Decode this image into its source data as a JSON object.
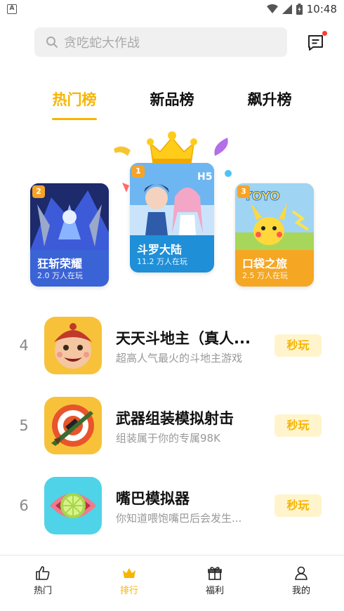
{
  "status_bar": {
    "time": "10:48"
  },
  "search": {
    "placeholder": "贪吃蛇大作战"
  },
  "tabs": [
    {
      "label": "热门榜",
      "active": true
    },
    {
      "label": "新品榜",
      "active": false
    },
    {
      "label": "飙升榜",
      "active": false
    }
  ],
  "podium": [
    {
      "rank": "1",
      "name": "斗罗大陆",
      "plays": "11.2 万人在玩"
    },
    {
      "rank": "2",
      "name": "狂斩荣耀",
      "plays": "2.0 万人在玩"
    },
    {
      "rank": "3",
      "name": "口袋之旅",
      "plays": "2.5 万人在玩"
    }
  ],
  "list": [
    {
      "rank": "4",
      "title": "天天斗地主（真人...",
      "desc": "超高人气最火的斗地主游戏",
      "button": "秒玩"
    },
    {
      "rank": "5",
      "title": "武器组装模拟射击",
      "desc": "组装属于你的专属98K",
      "button": "秒玩"
    },
    {
      "rank": "6",
      "title": "嘴巴模拟器",
      "desc": "你知道喂饱嘴巴后会发生...",
      "button": "秒玩"
    }
  ],
  "bottom_nav": [
    {
      "label": "热门",
      "icon": "thumbs-up-icon",
      "active": false
    },
    {
      "label": "排行",
      "icon": "crown-icon",
      "active": true
    },
    {
      "label": "福利",
      "icon": "gift-icon",
      "active": false
    },
    {
      "label": "我的",
      "icon": "user-icon",
      "active": false
    }
  ],
  "colors": {
    "accent": "#f7b500",
    "button_bg": "#fff4cc",
    "badge": "#f7a325"
  }
}
